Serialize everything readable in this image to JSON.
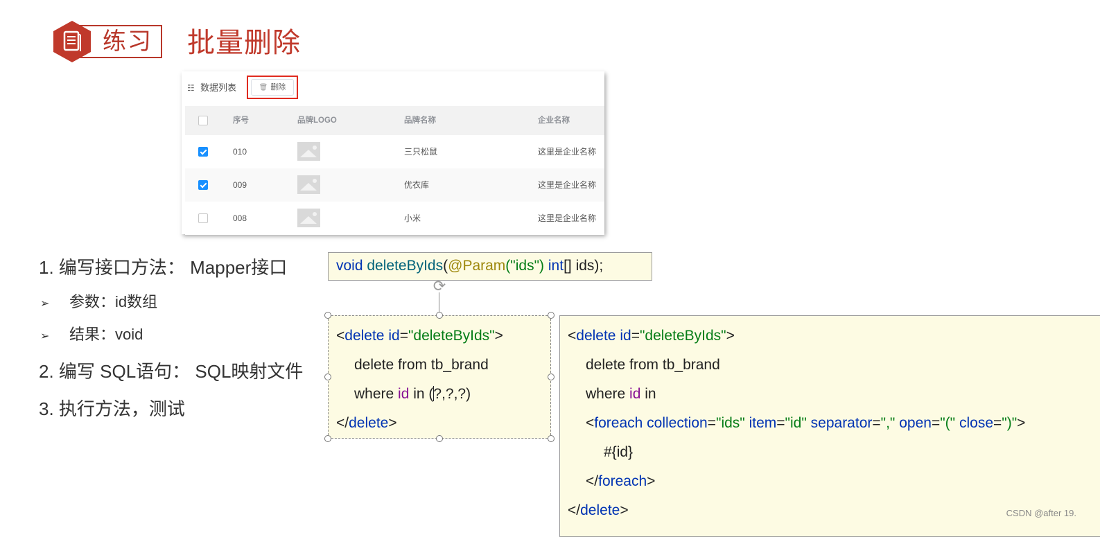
{
  "header": {
    "badge_label": "练习",
    "title": "批量删除"
  },
  "table_panel": {
    "list_label": "数据列表",
    "delete_label": "删除",
    "columns": [
      "序号",
      "品牌LOGO",
      "品牌名称",
      "企业名称"
    ],
    "rows": [
      {
        "checked": true,
        "index": "010",
        "brand": "三只松鼠",
        "company": "这里是企业名称"
      },
      {
        "checked": true,
        "index": "009",
        "brand": "优衣库",
        "company": "这里是企业名称"
      },
      {
        "checked": false,
        "index": "008",
        "brand": "小米",
        "company": "这里是企业名称"
      }
    ]
  },
  "steps": {
    "step1": "1.   编写接口方法： Mapper接口",
    "param": "参数：id数组",
    "result": "结果：void",
    "step2": "2.   编写 SQL语句： SQL映射文件",
    "step3": "3.   执行方法，测试"
  },
  "code": {
    "mapper_signature": {
      "void": "void",
      "method": "deleteByIds",
      "paren_open": "(",
      "annotation": "@Param",
      "ann_arg": "(\"ids\")",
      "type": "int",
      "rest": "[] ids);"
    },
    "simple_xml": {
      "line1_open": "<",
      "line1_tag": "delete",
      "line1_attr": "id",
      "line1_eq": "=",
      "line1_val": "\"deleteByIds\"",
      "line1_close": ">",
      "line2": "delete from tb_brand",
      "line3_where": "where ",
      "line3_col": "id",
      "line3_in": " in (",
      "line3_params": "?,?,?)",
      "line4_open": "</",
      "line4_tag": "delete",
      "line4_close": ">"
    },
    "foreach_xml": {
      "line1_open": "<",
      "line1_tag": "delete",
      "line1_attr": "id",
      "line1_eq": "=",
      "line1_val": "\"deleteByIds\"",
      "line1_close": ">",
      "line2": "delete from tb_brand",
      "line3_where": "where ",
      "line3_col": "id",
      "line3_in": " in",
      "line4_open": "<",
      "line4_tag": "foreach",
      "attr_collection": "collection",
      "val_collection": "\"ids\"",
      "attr_item": "item",
      "val_item": "\"id\"",
      "attr_separator": "separator",
      "val_separator": "\",\"",
      "attr_open": "open",
      "val_open": "\"(\"",
      "attr_close": "close",
      "val_close": "\")\"",
      "line4_end": ">",
      "line5": "#{id}",
      "line6_open": "</",
      "line6_tag": "foreach",
      "line6_close": ">",
      "line7_open": "</",
      "line7_tag": "delete",
      "line7_close": ">"
    }
  },
  "watermark": "CSDN @after 19.",
  "colors": {
    "accent_red": "#c0392b",
    "checkbox_blue": "#1890ff",
    "code_bg": "#fdfbe3"
  },
  "icons": {
    "badge": "document-hexagon-icon",
    "list": "list-icon",
    "delete": "trash-icon",
    "rotate": "rotate-handle-icon"
  }
}
